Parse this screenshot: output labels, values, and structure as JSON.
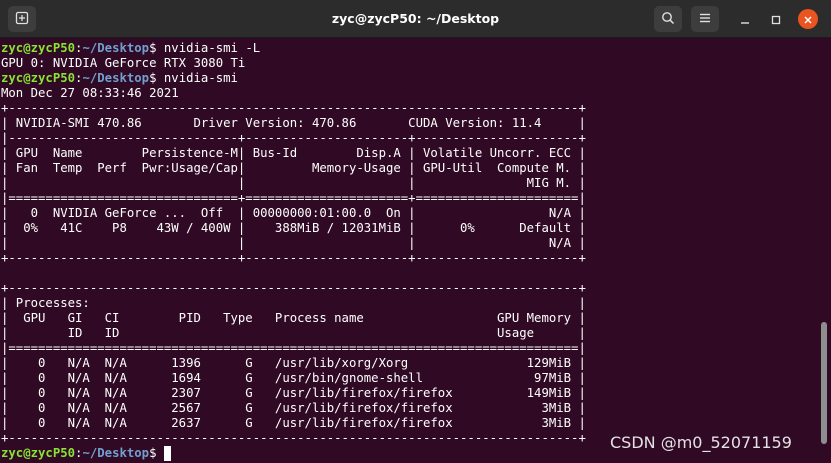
{
  "window": {
    "title": "zyc@zycP50: ~/Desktop",
    "icons": {
      "new_tab": "new-tab-icon",
      "search": "search-icon",
      "menu": "hamburger-menu-icon",
      "minimize": "minimize-icon",
      "maximize": "maximize-icon",
      "close": "close-icon"
    },
    "colors": {
      "terminal_bg": "#300a24",
      "prompt_user": "#8ae234",
      "prompt_path": "#729fcf",
      "close_button": "#e95420"
    }
  },
  "prompt": {
    "user_host": "zyc@zycP50",
    "sep": ":",
    "path": "~/Desktop",
    "symbol": "$"
  },
  "commands": [
    "nvidia-smi -L",
    "nvidia-smi"
  ],
  "output": {
    "gpu_list": "GPU 0: NVIDIA GeForce RTX 3080 Ti",
    "timestamp": "Mon Dec 27 08:33:46 2021",
    "smi_table": [
      "+-----------------------------------------------------------------------------+",
      "| NVIDIA-SMI 470.86       Driver Version: 470.86       CUDA Version: 11.4     |",
      "|-------------------------------+----------------------+----------------------+",
      "| GPU  Name        Persistence-M| Bus-Id        Disp.A | Volatile Uncorr. ECC |",
      "| Fan  Temp  Perf  Pwr:Usage/Cap|         Memory-Usage | GPU-Util  Compute M. |",
      "|                               |                      |               MIG M. |",
      "|===============================+======================+======================|",
      "|   0  NVIDIA GeForce ...  Off  | 00000000:01:00.0  On |                  N/A |",
      "|  0%   41C    P8    43W / 400W |    388MiB / 12031MiB |      0%      Default |",
      "|                               |                      |                  N/A |",
      "+-------------------------------+----------------------+----------------------+",
      "",
      "+-----------------------------------------------------------------------------+",
      "| Processes:                                                                  |",
      "|  GPU   GI   CI        PID   Type   Process name                  GPU Memory |",
      "|        ID   ID                                                   Usage      |",
      "|=============================================================================|",
      "|    0   N/A  N/A      1396      G   /usr/lib/xorg/Xorg                129MiB |",
      "|    0   N/A  N/A      1694      G   /usr/bin/gnome-shell               97MiB |",
      "|    0   N/A  N/A      2307      G   /usr/lib/firefox/firefox          149MiB |",
      "|    0   N/A  N/A      2567      G   /usr/lib/firefox/firefox            3MiB |",
      "|    0   N/A  N/A      2637      G   /usr/lib/firefox/firefox            3MiB |",
      "+-----------------------------------------------------------------------------+"
    ]
  },
  "watermark": "CSDN @m0_52071159"
}
